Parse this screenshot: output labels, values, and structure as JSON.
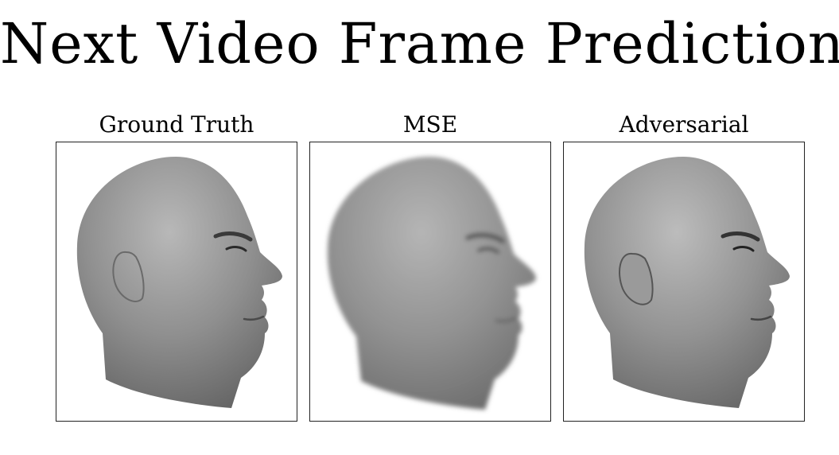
{
  "slide": {
    "title": "Next Video Frame Prediction"
  },
  "panels": [
    {
      "label": "Ground Truth",
      "image": "head-profile-sharp"
    },
    {
      "label": "MSE",
      "image": "head-profile-blurry"
    },
    {
      "label": "Adversarial",
      "image": "head-profile-sharp"
    }
  ]
}
